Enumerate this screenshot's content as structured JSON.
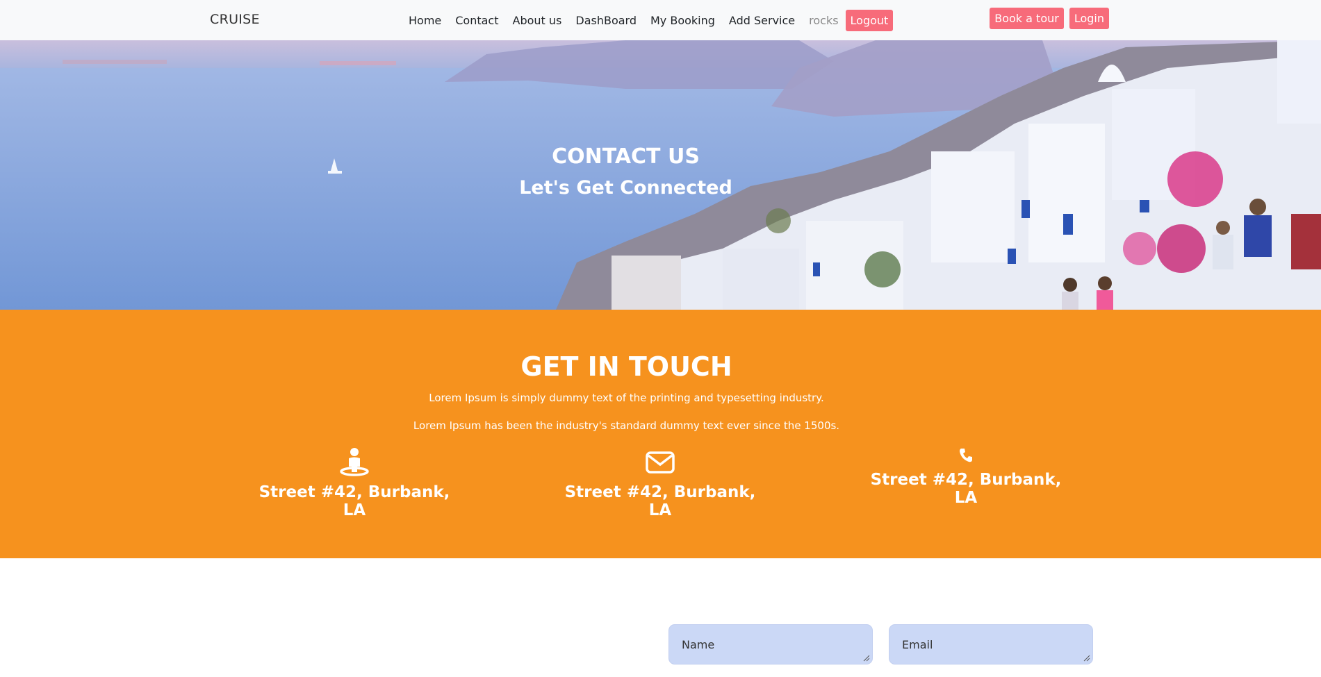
{
  "navbar": {
    "brand": "CRUISE",
    "links": [
      "Home",
      "Contact",
      "About us",
      "DashBoard",
      "My Booking",
      "Add Service"
    ],
    "username": "rocks",
    "logout_label": "Logout",
    "book_tour_label": "Book a tour",
    "login_label": "Login"
  },
  "hero": {
    "title": "CONTACT US",
    "subtitle": "Let's Get Connected"
  },
  "touch": {
    "title": "GET IN TOUCH",
    "line1": "Lorem Ipsum is simply dummy text of the printing and typesetting industry.",
    "line2": "Lorem Ipsum has been the industry's standard dummy text ever since the 1500s.",
    "items": [
      {
        "icon": "location-person-icon",
        "label": "Street #42, Burbank, LA"
      },
      {
        "icon": "envelope-icon",
        "label": "Street #42, Burbank, LA"
      },
      {
        "icon": "phone-icon",
        "label": "Street #42, Burbank, LA"
      }
    ]
  },
  "form": {
    "name_placeholder": "Name",
    "email_placeholder": "Email"
  },
  "colors": {
    "accent_pink": "#f76b7a",
    "orange": "#f6921e",
    "field_bg": "#cbd8f6"
  }
}
